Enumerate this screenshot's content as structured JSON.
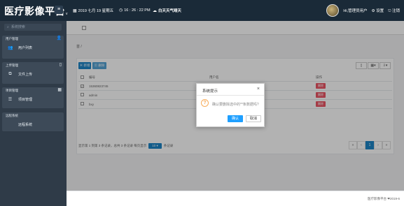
{
  "header": {
    "brand": "医疗影像平台",
    "brand_suffix": "v",
    "date": "2019 七月 19 星期五",
    "time": "16 : 26 : 22 PM",
    "weather": "白天天气晴天",
    "user_greeting": "Hi,管理员用户",
    "settings_label": "设置",
    "logout_label": "注销"
  },
  "sidebar": {
    "search_placeholder": "系统搜索",
    "groups": [
      {
        "title": "用户管理",
        "item": "用户列表"
      },
      {
        "title": "上传管理",
        "item": "文件上传"
      },
      {
        "title": "项目管理",
        "item": "项目管理"
      },
      {
        "title": "远程系统",
        "item": "远程系统"
      }
    ]
  },
  "main": {
    "breadcrumb": "首 /",
    "add_label": "新增",
    "delete_label": "删除",
    "columns": [
      "编号",
      "用户名",
      "操作"
    ],
    "rows": [
      {
        "id": "15360823745",
        "name": "",
        "action": "删除"
      },
      {
        "id": "admin",
        "name": "",
        "action": "删除"
      },
      {
        "id": "bxy",
        "name": "",
        "action": "删除"
      }
    ],
    "page_info_before": "显示第 1 到第 3 条记录，总共 3 条记录 每页显示",
    "page_size": "10",
    "page_info_after": "条记录",
    "pager": [
      "«",
      "‹",
      "1",
      "›",
      "»"
    ],
    "footer": "医疗影像平台 ❤2019-6"
  },
  "dialog": {
    "title": "系统提示",
    "message": "确认要删除选中的**条数据吗?",
    "ok_label": "确认",
    "cancel_label": "取消"
  }
}
